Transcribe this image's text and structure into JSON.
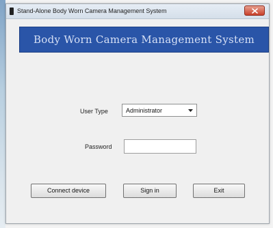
{
  "window": {
    "title": "Stand-Alone Body Worn Camera Management System"
  },
  "banner": {
    "text": "Body Worn Camera Management System"
  },
  "form": {
    "user_type_label": "User Type",
    "user_type_value": "Administrator",
    "password_label": "Password",
    "password_value": ""
  },
  "buttons": {
    "connect_label": "Connect device",
    "signin_label": "Sign in",
    "exit_label": "Exit"
  },
  "colors": {
    "banner_bg": "#2a55a8",
    "close_button": "#c8402a"
  }
}
